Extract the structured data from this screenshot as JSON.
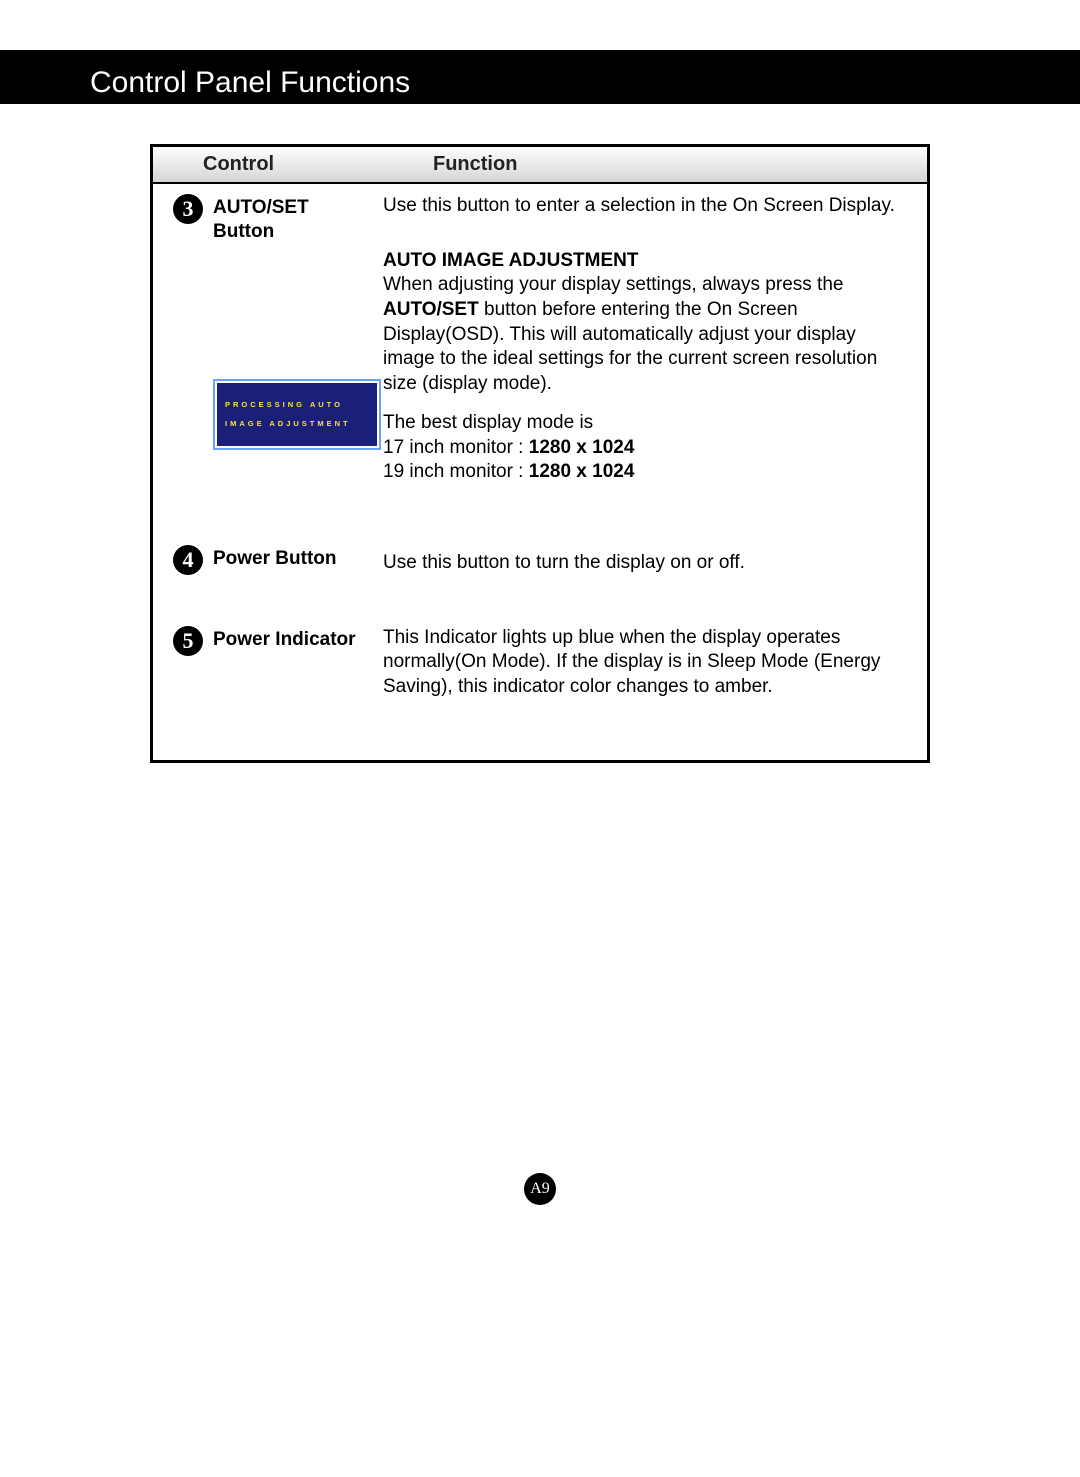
{
  "page_title": "Control Panel Functions",
  "table": {
    "headers": {
      "control": "Control",
      "function": "Function"
    },
    "rows": [
      {
        "num": "3",
        "label_line1": "AUTO/SET",
        "label_line2": "Button",
        "desc": "Use this button to enter a selection in the On Screen Display.",
        "sub": {
          "heading": "AUTO IMAGE ADJUSTMENT",
          "text_before": "When adjusting your display settings, always press the ",
          "bold_inline": "AUTO/SET",
          "text_after": " button before entering the On Screen Display(OSD). This will automatically adjust your display image to the ideal settings for the current screen resolution size (display mode).",
          "best_mode_intro": "The best display mode is",
          "modes": [
            {
              "label": "17 inch monitor : ",
              "res": "1280 x 1024"
            },
            {
              "label": "19 inch monitor : ",
              "res": "1280 x 1024"
            }
          ],
          "osd_line1": "PROCESSING AUTO",
          "osd_line2": "IMAGE ADJUSTMENT"
        }
      },
      {
        "num": "4",
        "label_line1": "Power Button",
        "label_line2": "",
        "desc": "Use this button to turn the display on or off."
      },
      {
        "num": "5",
        "label_line1": "Power Indicator",
        "label_line2": "",
        "desc": "This Indicator lights up blue when the display operates normally(On Mode). If the display is in Sleep Mode (Energy Saving), this indicator color changes to amber."
      }
    ]
  },
  "page_number": "A9"
}
